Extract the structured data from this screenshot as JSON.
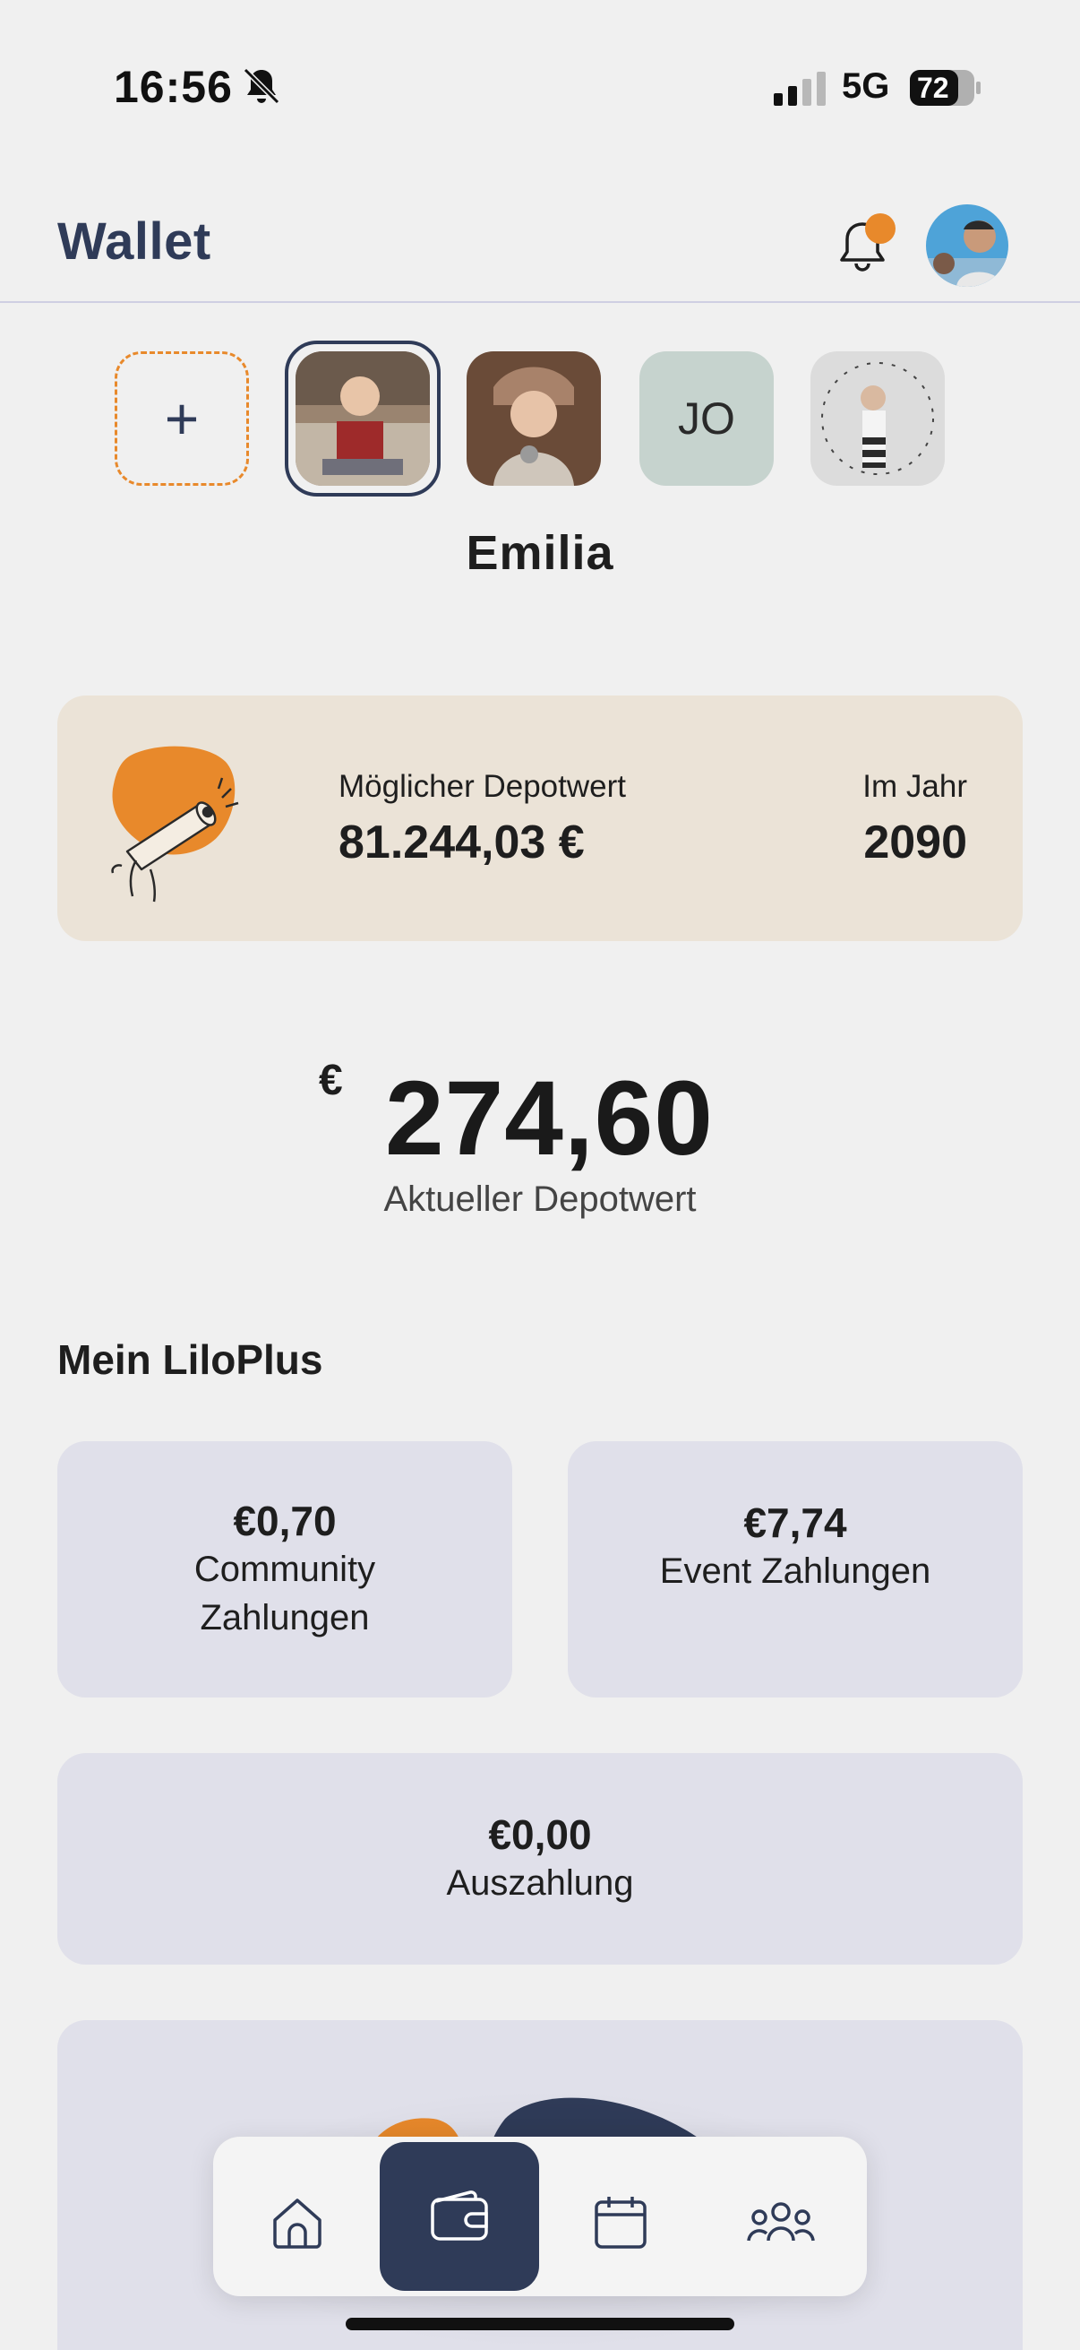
{
  "status_bar": {
    "time": "16:56",
    "network": "5G",
    "battery": "72",
    "icons": [
      "bell-slash-icon",
      "signal-icon",
      "battery-icon"
    ]
  },
  "header": {
    "title": "Wallet",
    "notification_icon": "bell-icon",
    "profile_icon": "user-avatar"
  },
  "children": {
    "add_label": "+",
    "selected_name": "Emilia",
    "initials_tile": "JO"
  },
  "projection": {
    "label": "Möglicher Depotwert",
    "value": "81.244,03 €",
    "year_label": "Im Jahr",
    "year": "2090"
  },
  "current": {
    "currency": "€",
    "value": "274,60",
    "label": "Aktueller Depotwert"
  },
  "lilo_plus": {
    "title": "Mein LiloPlus",
    "cards": [
      {
        "value": "€0,70",
        "label_line1": "Community",
        "label_line2": "Zahlungen"
      },
      {
        "value": "€7,74",
        "label_line1": "Event Zahlungen"
      },
      {
        "value": "€0,00",
        "label_line1": "Auszahlung"
      }
    ]
  },
  "nav": {
    "items": [
      "home-icon",
      "wallet-icon",
      "calendar-icon",
      "community-icon"
    ],
    "active": "wallet-icon"
  },
  "colors": {
    "accent": "#e8892b",
    "navy": "#2f3b58",
    "card_beige": "#ebe3d7",
    "card_lilac": "#e0e0ea",
    "background": "#f0f0f0"
  }
}
